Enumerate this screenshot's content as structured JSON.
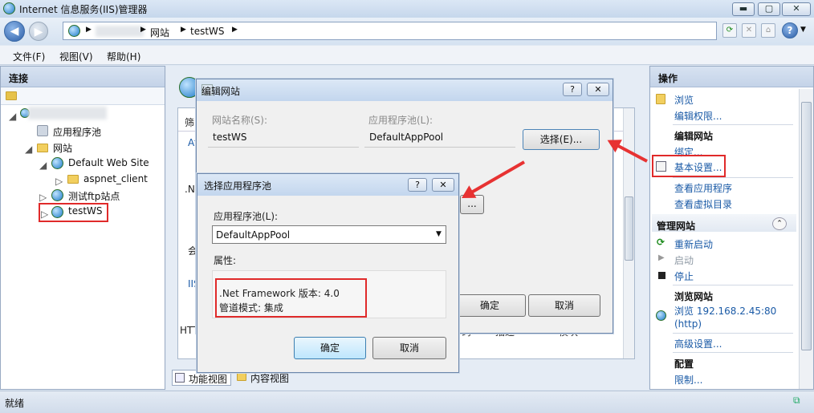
{
  "window": {
    "title": "Internet 信息服务(IIS)管理器",
    "min": "▬",
    "max": "▢",
    "close": "✕"
  },
  "nav": {
    "breadcrumb_site": "网站",
    "breadcrumb_node": "testWS",
    "help": "?"
  },
  "menu": {
    "file": "文件(F)",
    "view": "视图(V)",
    "help": "帮助(H)"
  },
  "left": {
    "header": "连接",
    "tree": {
      "app_pools": "应用程序池",
      "sites": "网站",
      "default_site": "Default Web Site",
      "aspnet_client": "aspnet_client",
      "ftp_site": "测试ftp站点",
      "testws": "testWS"
    }
  },
  "center": {
    "filter_label": "筛",
    "frag1": "At",
    "frag2": ".N",
    "frag3": "会",
    "frag4": "IIS",
    "frag5": "HTT",
    "frag6": "码",
    "frag7": "描述",
    "frag8": "模块"
  },
  "bottom_tabs": {
    "features": "功能视图",
    "content": "内容视图"
  },
  "status": {
    "text": "就绪"
  },
  "right": {
    "header": "操作",
    "browse": "浏览",
    "edit_perms": "编辑权限...",
    "edit_site": "编辑网站",
    "bindings": "绑定...",
    "basic_settings": "基本设置...",
    "view_apps": "查看应用程序",
    "view_vdirs": "查看虚拟目录",
    "manage_site": "管理网站",
    "restart": "重新启动",
    "start": "启动",
    "stop": "停止",
    "browse_site": "浏览网站",
    "browse_url": "浏览 192.168.2.45:80",
    "browse_proto": "(http)",
    "advanced": "高级设置...",
    "config": "配置",
    "limits": "限制..."
  },
  "edit_dialog": {
    "title": "编辑网站",
    "help": "?",
    "close": "✕",
    "site_name_label": "网站名称(S):",
    "site_name": "testWS",
    "pool_label": "应用程序池(L):",
    "pool_value": "DefaultAppPool",
    "select_button": "选择(E)...",
    "ellipsis_button": "...",
    "ok": "确定",
    "cancel": "取消"
  },
  "pool_dialog": {
    "title": "选择应用程序池",
    "help": "?",
    "close": "✕",
    "pool_label": "应用程序池(L):",
    "pool_selected": "DefaultAppPool",
    "props_label": "属性:",
    "framework": ".Net Framework 版本: 4.0",
    "pipeline": "管道模式: 集成",
    "ok": "确定",
    "cancel": "取消"
  }
}
